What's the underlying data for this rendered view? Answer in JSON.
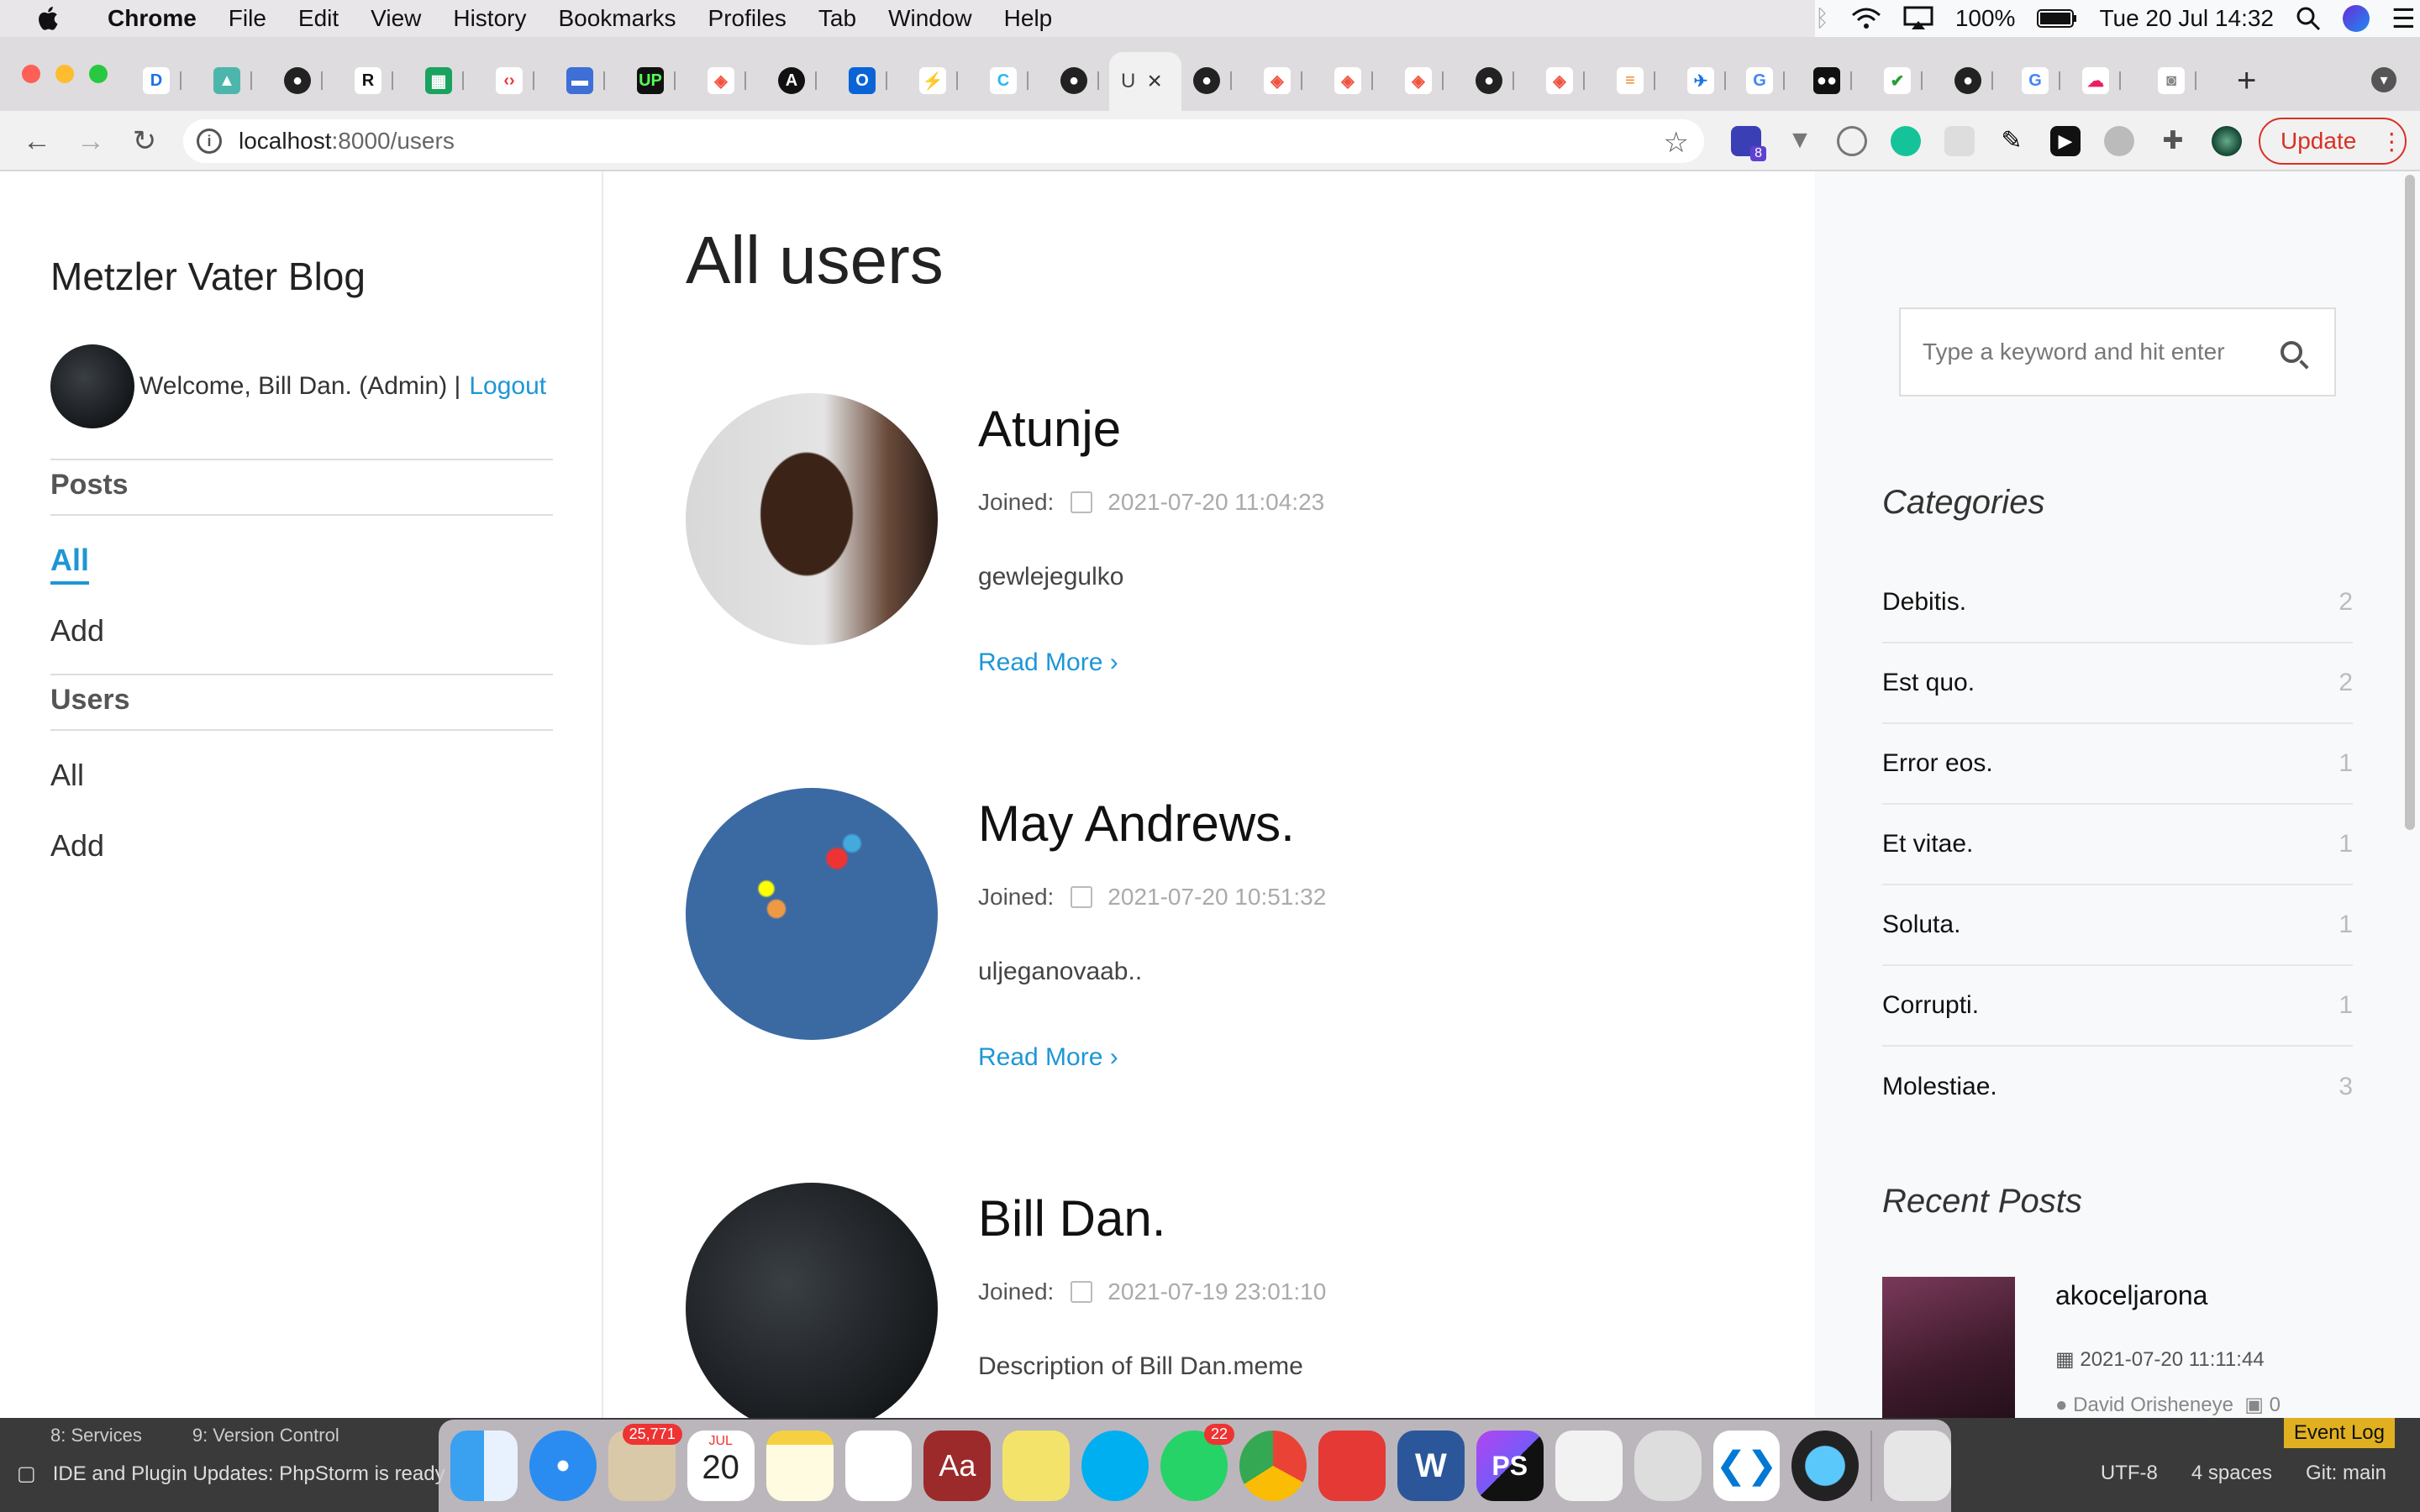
{
  "menubar": {
    "app_name": "Chrome",
    "items": [
      "File",
      "Edit",
      "View",
      "History",
      "Bookmarks",
      "Profiles",
      "Tab",
      "Window",
      "Help"
    ],
    "battery": "100%",
    "clock": "Tue 20 Jul  14:32"
  },
  "browser": {
    "url_host": "localhost",
    "url_rest": ":8000/users",
    "update_label": "Update",
    "extension_badge": "8"
  },
  "sidebar": {
    "blog_title": "Metzler Vater Blog",
    "welcome_text": "Welcome, Bill Dan. (Admin) |",
    "logout_label": "Logout",
    "posts_heading": "Posts",
    "posts_all": "All",
    "posts_add": "Add",
    "users_heading": "Users",
    "users_all": "All",
    "users_add": "Add"
  },
  "main": {
    "title": "All users",
    "joined_label": "Joined:",
    "read_more": "Read More ›",
    "users": [
      {
        "name": "Atunje",
        "joined": "2021-07-20 11:04:23",
        "description": "gewlejegulko"
      },
      {
        "name": "May Andrews.",
        "joined": "2021-07-20 10:51:32",
        "description": "uljeganovaab.."
      },
      {
        "name": "Bill Dan.",
        "joined": "2021-07-19 23:01:10",
        "description": "Description of Bill Dan.meme"
      }
    ]
  },
  "rightbar": {
    "search_placeholder": "Type a keyword and hit enter",
    "categories_title": "Categories",
    "categories": [
      {
        "name": "Debitis.",
        "count": "2"
      },
      {
        "name": "Est quo.",
        "count": "2"
      },
      {
        "name": "Error eos.",
        "count": "1"
      },
      {
        "name": "Et vitae.",
        "count": "1"
      },
      {
        "name": "Soluta.",
        "count": "1"
      },
      {
        "name": "Corrupti.",
        "count": "1"
      },
      {
        "name": "Molestiae.",
        "count": "3"
      }
    ],
    "recent_title": "Recent Posts",
    "recent": {
      "title": "akoceljarona",
      "date": "2021-07-20 11:11:44",
      "author": "David Orisheneye",
      "comments": "0"
    }
  },
  "ide": {
    "services": "8: Services",
    "vcs": "9: Version Control",
    "notice": "IDE and Plugin Updates: PhpStorm is ready t",
    "encoding": "UTF-8",
    "indent": "4 spaces",
    "branch": "Git: main",
    "event_log": "Event Log"
  },
  "dock": {
    "mail_badge": "25,771",
    "whatsapp_badge": "22",
    "calendar_month": "JUL",
    "calendar_day": "20"
  },
  "colors": {
    "accent": "#1e96d6",
    "update_red": "#d93025"
  }
}
